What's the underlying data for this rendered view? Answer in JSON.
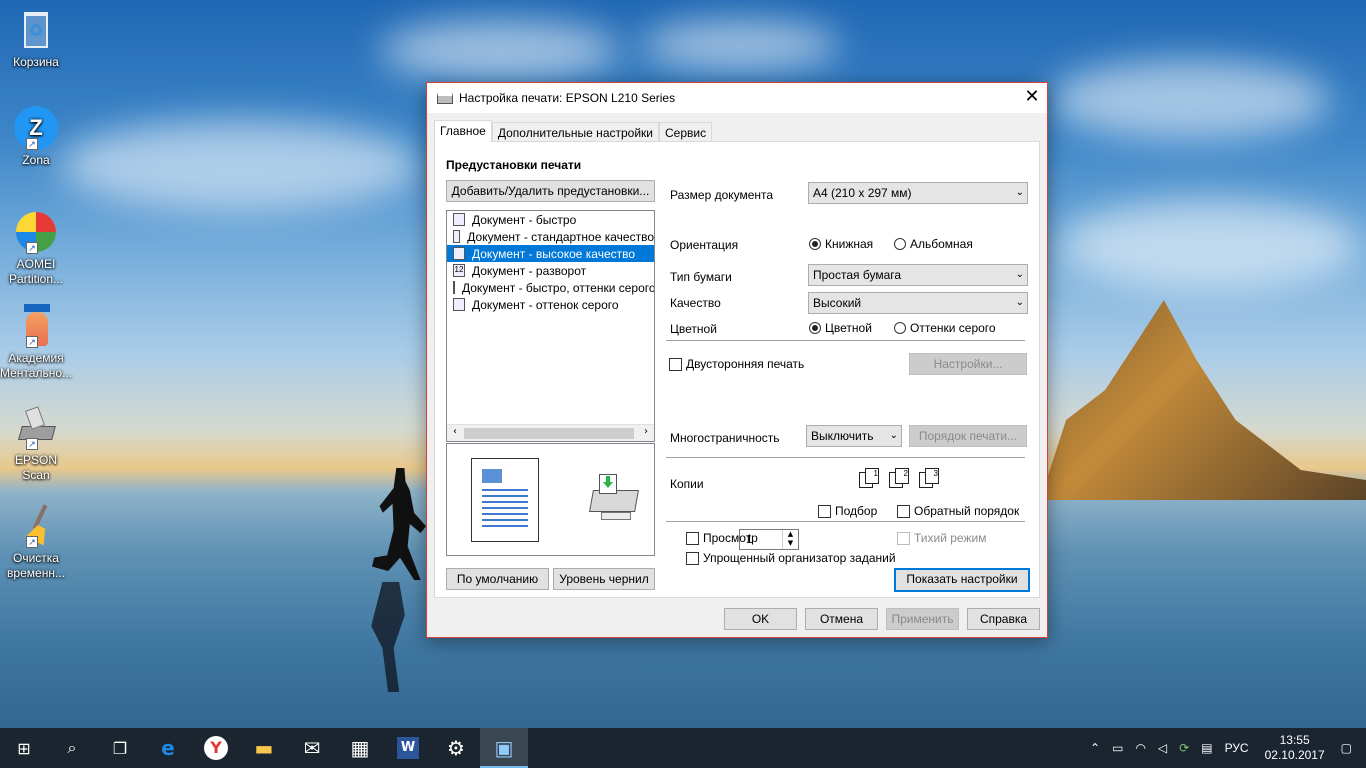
{
  "desktop": {
    "icons": [
      {
        "label": "Корзина",
        "icon": "recycle-bin-icon"
      },
      {
        "label": "Zona",
        "icon": "zona-icon"
      },
      {
        "label": "AOMEI Partition...",
        "icon": "aomei-icon"
      },
      {
        "label": "Академия Ментально...",
        "icon": "academy-icon"
      },
      {
        "label": "EPSON Scan",
        "icon": "scanner-icon"
      },
      {
        "label": "Очистка временн...",
        "icon": "broom-icon"
      }
    ]
  },
  "dialog": {
    "title": "Настройка печати: EPSON L210 Series",
    "close_glyph": "✕",
    "tabs": [
      {
        "label": "Главное",
        "active": true
      },
      {
        "label": "Дополнительные настройки",
        "active": false
      },
      {
        "label": "Сервис",
        "active": false
      }
    ],
    "presets": {
      "heading": "Предустановки печати",
      "add_remove_button": "Добавить/Удалить предустановки...",
      "items": [
        {
          "label": "Документ - быстро",
          "selected": false
        },
        {
          "label": "Документ - стандартное качество",
          "selected": false
        },
        {
          "label": "Документ - высокое качество",
          "selected": true
        },
        {
          "label": "Документ - разворот",
          "selected": false
        },
        {
          "label": "Документ - быстро, оттенки серого",
          "selected": false
        },
        {
          "label": "Документ - оттенок серого",
          "selected": false
        }
      ]
    },
    "left_buttons": {
      "defaults": "По умолчанию",
      "ink_levels": "Уровень чернил"
    },
    "settings": {
      "doc_size_label": "Размер документа",
      "doc_size_value": "A4 (210 x 297 мм)",
      "orientation_label": "Ориентация",
      "orientation_portrait": "Книжная",
      "orientation_landscape": "Альбомная",
      "orientation_selected": "portrait",
      "paper_type_label": "Тип бумаги",
      "paper_type_value": "Простая бумага",
      "quality_label": "Качество",
      "quality_value": "Высокий",
      "color_label": "Цветной",
      "color_color": "Цветной",
      "color_gray": "Оттенки серого",
      "color_selected": "color",
      "duplex_label": "Двусторонняя печать",
      "duplex_settings_button": "Настройки...",
      "multipage_label": "Многостраничность",
      "multipage_value": "Выключить",
      "print_order_button": "Порядок печати...",
      "copies_label": "Копии",
      "copies_value": "1",
      "collate_label": "Подбор",
      "reverse_order_label": "Обратный порядок",
      "preview_label": "Просмотр",
      "quiet_mode_label": "Тихий режим",
      "simple_organizer_label": "Упрощенный организатор заданий",
      "show_settings_button": "Показать настройки"
    },
    "footer": {
      "ok": "OK",
      "cancel": "Отмена",
      "apply": "Применить",
      "help": "Справка"
    }
  },
  "taskbar": {
    "items": [
      {
        "name": "start-icon",
        "glyph": "⊞"
      },
      {
        "name": "search-icon",
        "glyph": "⌕"
      },
      {
        "name": "task-view-icon",
        "glyph": "❐"
      },
      {
        "name": "edge-icon",
        "glyph": "e"
      },
      {
        "name": "yandex-icon",
        "glyph": "Y"
      },
      {
        "name": "file-explorer-icon",
        "glyph": "▬"
      },
      {
        "name": "mail-icon",
        "glyph": "✉"
      },
      {
        "name": "calculator-icon",
        "glyph": "▦"
      },
      {
        "name": "word-icon",
        "glyph": "W"
      },
      {
        "name": "settings-gear-icon",
        "glyph": "⚙"
      },
      {
        "name": "printer-settings-app-icon",
        "glyph": "▣"
      }
    ],
    "tray": {
      "language": "РУС",
      "time": "13:55",
      "date": "02.10.2017"
    }
  }
}
